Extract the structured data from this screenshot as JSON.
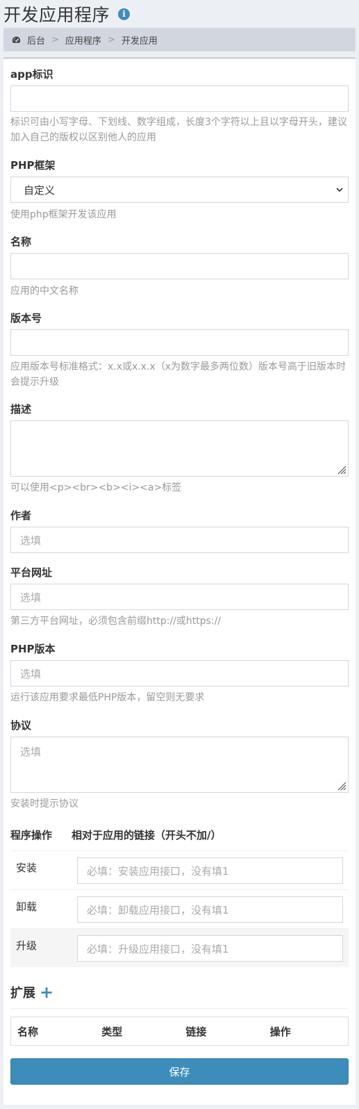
{
  "header": {
    "title": "开发应用程序",
    "info_icon": "info-icon"
  },
  "breadcrumb": {
    "items": [
      "后台",
      "应用程序",
      "开发应用"
    ],
    "separator": ">"
  },
  "form": {
    "app_id": {
      "label": "app标识",
      "value": "",
      "help": "标识可由小写字母、下划线、数字组成，长度3个字符以上且以字母开头，建议加入自己的版权以区别他人的应用"
    },
    "framework": {
      "label": "PHP框架",
      "selected": "自定义",
      "help": "使用php框架开发该应用"
    },
    "name": {
      "label": "名称",
      "value": "",
      "help": "应用的中文名称"
    },
    "version": {
      "label": "版本号",
      "value": "",
      "help": "应用版本号标准格式：x.x或x.x.x（x为数字最多两位数）版本号高于旧版本时会提示升级"
    },
    "description": {
      "label": "描述",
      "value": "",
      "help": "可以使用<p><br><b><i><a>标签"
    },
    "author": {
      "label": "作者",
      "placeholder": "选填"
    },
    "website": {
      "label": "平台网址",
      "placeholder": "选填",
      "help": "第三方平台网址，必须包含前缀http://或https://"
    },
    "php_version": {
      "label": "PHP版本",
      "placeholder": "选填",
      "help": "运行该应用要求最低PHP版本，留空则无要求"
    },
    "agreement": {
      "label": "协议",
      "placeholder": "选填",
      "help": "安装时提示协议"
    }
  },
  "operations": {
    "headers": [
      "程序操作",
      "相对于应用的链接（开头不加/）"
    ],
    "rows": [
      {
        "label": "安装",
        "placeholder": "必填：安装应用接口，没有填1"
      },
      {
        "label": "卸载",
        "placeholder": "必填：卸载应用接口，没有填1"
      },
      {
        "label": "升级",
        "placeholder": "必填：升级应用接口，没有填1"
      }
    ]
  },
  "extensions": {
    "title": "扩展",
    "columns": [
      "名称",
      "类型",
      "链接",
      "操作"
    ]
  },
  "save_label": "保存",
  "colors": {
    "primary": "#3c8dbc",
    "breadcrumb_bg": "#d2d6de",
    "page_bg": "#ecf0f5"
  }
}
